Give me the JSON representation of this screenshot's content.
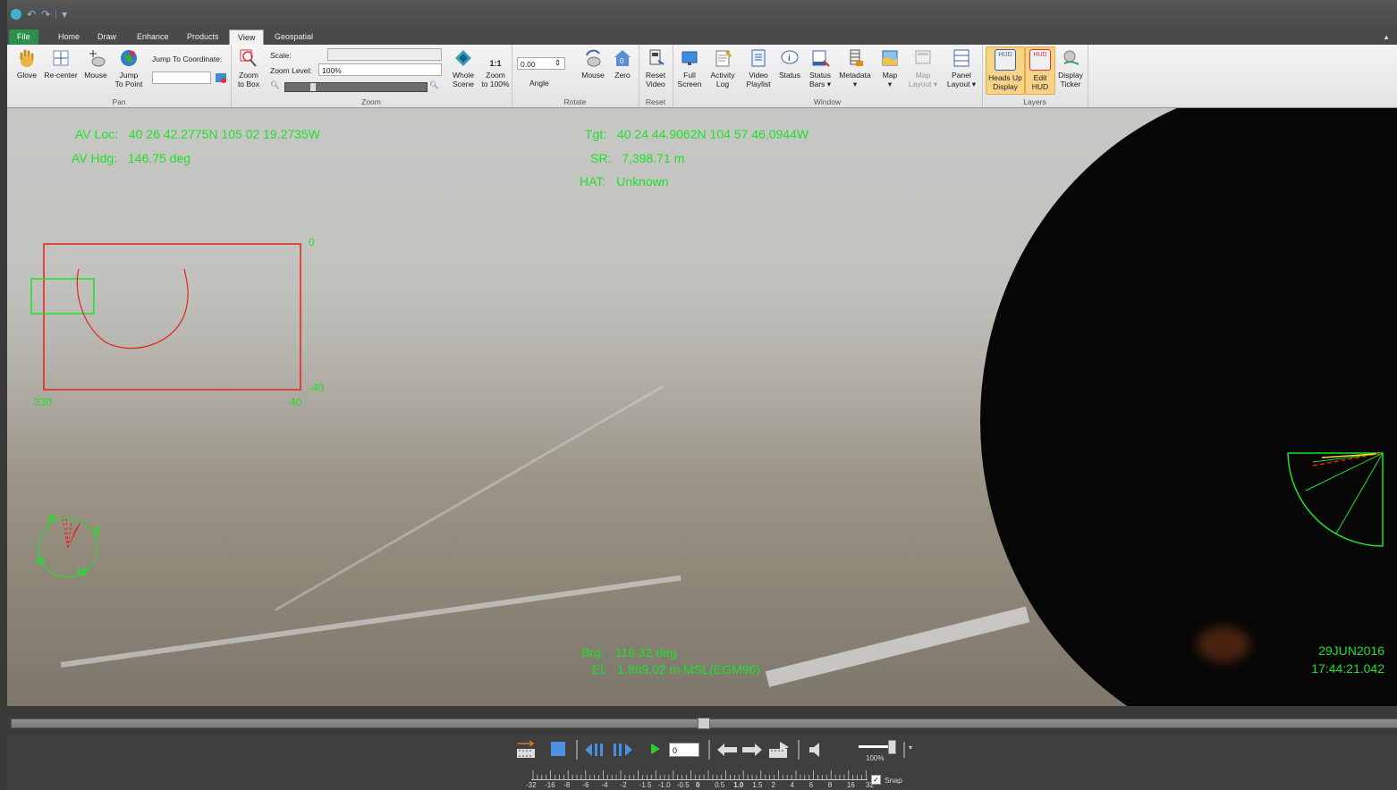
{
  "ribbon_tabs": [
    "File",
    "Home",
    "Draw",
    "Enhance",
    "Products",
    "View",
    "Geospatial"
  ],
  "active_tab": "View",
  "pan": {
    "group": "Pan",
    "glove": "Glove",
    "recenter": "Re-center",
    "mouse": "Mouse",
    "jump_to_point": [
      "Jump",
      "To Point"
    ],
    "jump_label": "Jump To Coordinate:"
  },
  "zoom": {
    "group": "Zoom",
    "zoom_to_box": [
      "Zoom",
      "to Box"
    ],
    "scale_label": "Scale:",
    "scale_value": "",
    "zoom_level_label": "Zoom Level:",
    "zoom_level_value": "100%",
    "whole_scene": [
      "Whole",
      "Scene"
    ],
    "zoom_100": [
      "Zoom",
      "to 100%"
    ],
    "zoom_icon_text": "1:1"
  },
  "rotate": {
    "group": "Rotate",
    "angle_value": "0.00",
    "angle_label": "Angle",
    "mouse": "Mouse",
    "zero": "Zero"
  },
  "reset": {
    "group": "Reset",
    "reset_video": [
      "Reset",
      "Video"
    ]
  },
  "window": {
    "group": "Window",
    "full_screen": [
      "Full",
      "Screen"
    ],
    "activity_log": [
      "Activity",
      "Log"
    ],
    "video_playlist": [
      "Video",
      "Playlist"
    ],
    "status": "Status",
    "status_bars": [
      "Status",
      "Bars"
    ],
    "metadata": "Metadata",
    "map": "Map",
    "map_layout": [
      "Map",
      "Layout"
    ],
    "panel_layout": [
      "Panel",
      "Layout"
    ]
  },
  "layers": {
    "group": "Layers",
    "heads_up": [
      "Heads Up",
      "Display"
    ],
    "edit_hud": [
      "Edit",
      "HUD"
    ],
    "display_ticker": [
      "Display",
      "Ticker"
    ],
    "hud_icon_text": "HUD"
  },
  "hud": {
    "av_loc_label": "AV Loc:",
    "av_loc": "40 26 42.2775N 105 02 19.2735W",
    "av_hdg_label": "AV Hdg:",
    "av_hdg": "146.75 deg",
    "tgt_label": "Tgt:",
    "tgt": "40 24 44.9062N 104 57 46.0944W",
    "sr_label": "SR:",
    "sr": "7,398.71 m",
    "hat_label": "HAT:",
    "hat": "Unknown",
    "brg_label": "Brg:",
    "brg": "119.32 deg",
    "el_label": "El:",
    "el": "1,889.02 m MSL(EGM96)",
    "date": "29JUN2016",
    "time": "17:44:21.042",
    "scale_top": "0",
    "scale_bottom": "-40",
    "scale_left": "330",
    "scale_right": "40",
    "compass": {
      "e": "E",
      "s": "S",
      "n": "N",
      "w": "W"
    }
  },
  "transport": {
    "frame_value": "0",
    "speed": "100%",
    "speed_fraction": 0.8,
    "scrub_position": 0.5,
    "ruler_ticks": [
      "-32",
      "-16",
      "-8",
      "-6",
      "-4",
      "-2",
      "-1.5",
      "-1.0",
      "-0.5",
      "0",
      "0.5",
      "1.0",
      "1.5",
      "2",
      "4",
      "6",
      "8",
      "16",
      "32"
    ],
    "snap_label": "Snap",
    "snap_checked": true
  },
  "colors": {
    "hud_green": "#1fe02a",
    "box_red": "#e8201a",
    "file_tab": "#2c8f4a",
    "layers_highlight": "#f7d38a"
  }
}
